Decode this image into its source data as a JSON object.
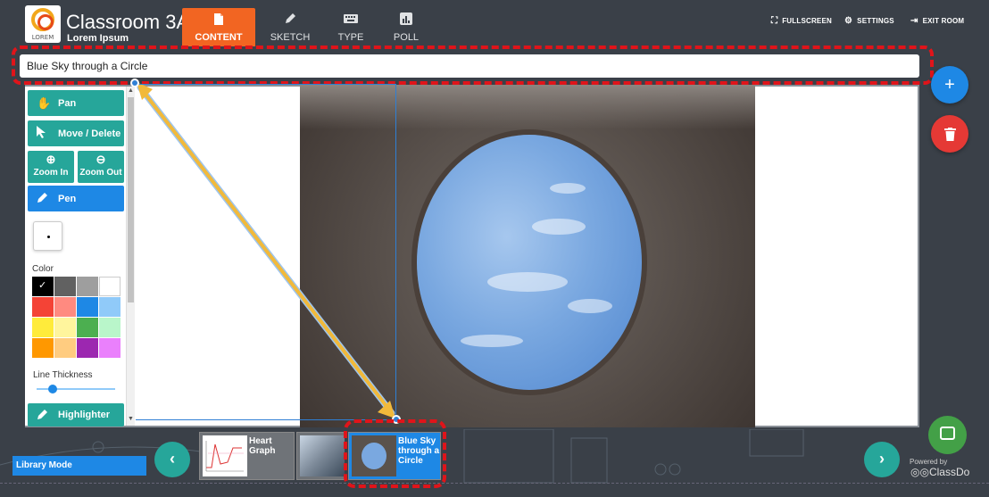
{
  "header": {
    "logo_text": "LOREM",
    "class_name": "Classroom 3A",
    "subtitle": "Lorem Ipsum",
    "tabs": [
      {
        "label": "CONTENT",
        "icon": "file-icon"
      },
      {
        "label": "SKETCH",
        "icon": "pencil-icon"
      },
      {
        "label": "TYPE",
        "icon": "keyboard-icon"
      },
      {
        "label": "POLL",
        "icon": "chart-icon"
      }
    ],
    "actions": [
      {
        "label": "FULLSCREEN",
        "icon": "fullscreen-icon"
      },
      {
        "label": "SETTINGS",
        "icon": "gear-icon"
      },
      {
        "label": "EXIT ROOM",
        "icon": "exit-icon"
      }
    ]
  },
  "content": {
    "title_value": "Blue Sky through a Circle"
  },
  "toolbar": {
    "pan": "Pan",
    "move_delete": "Move / Delete",
    "zoom_in": "Zoom In",
    "zoom_out": "Zoom Out",
    "pen": "Pen",
    "color_label": "Color",
    "colors": [
      "#000000",
      "#616161",
      "#9e9e9e",
      "#ffffff",
      "#f44336",
      "#ff8a80",
      "#1e88e5",
      "#90caf9",
      "#ffeb3b",
      "#fff59d",
      "#4caf50",
      "#b9f6ca",
      "#ff9800",
      "#ffcc80",
      "#9c27b0",
      "#ea80fc"
    ],
    "selected_color": "#000000",
    "line_thickness_label": "Line Thickness",
    "line_thickness": 0.2,
    "highlighter": "Highlighter"
  },
  "fabs": {
    "add": "+",
    "delete_icon": "trash-icon"
  },
  "bottom": {
    "library_mode": "Library Mode",
    "thumbnails": [
      {
        "label": "Heart Graph",
        "active": false
      },
      {
        "label": "",
        "active": false
      },
      {
        "label": "Blue Sky through a Circle",
        "active": true
      }
    ],
    "powered_by": "Powered by",
    "brand": "ClassDo"
  },
  "colors": {
    "accent_orange": "#f26522",
    "teal": "#26a69a",
    "blue": "#1e88e5",
    "red": "#e53935",
    "annotation_red": "#e0141a"
  }
}
